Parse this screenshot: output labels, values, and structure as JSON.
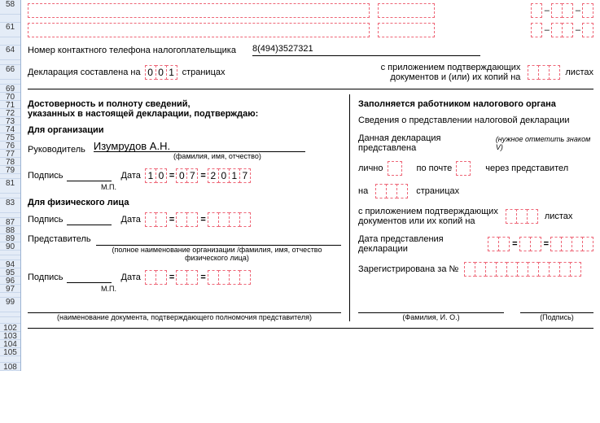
{
  "rownums": [
    "58",
    "",
    "61",
    "",
    "64",
    "",
    "66",
    "",
    "69",
    "70",
    "71",
    "72",
    "73",
    "74",
    "75",
    "76",
    "77",
    "78",
    "79",
    "",
    "81",
    "",
    "83",
    "",
    "87",
    "88",
    "89",
    "90",
    "",
    "",
    "94",
    "95",
    "96",
    "97",
    "",
    "99",
    "",
    "",
    "102",
    "103",
    "104",
    "105",
    "",
    "108"
  ],
  "rownum_heights": [
    18,
    10,
    18,
    10,
    18,
    6,
    18,
    6,
    10,
    10,
    10,
    10,
    10,
    10,
    10,
    10,
    10,
    10,
    10,
    6,
    18,
    6,
    18,
    6,
    10,
    10,
    10,
    10,
    6,
    6,
    10,
    10,
    10,
    10,
    6,
    18,
    6,
    8,
    10,
    10,
    10,
    10,
    8,
    10
  ],
  "phone": {
    "label": "Номер контактного телефона налогоплательщика",
    "value": "8(494)3527321"
  },
  "pages": {
    "prefix": "Декларация составлена на",
    "d": [
      "0",
      "0",
      "1"
    ],
    "suffix": "страницах"
  },
  "attach1": {
    "line1": "с приложением подтверждающих",
    "line2": "документов и (или) их копий на",
    "suffix": "листах"
  },
  "left": {
    "heading": [
      "Достоверность и полноту сведений,",
      "указанных в настоящей декларации, подтверждаю:"
    ],
    "org": "Для организации",
    "ruk": {
      "label": "Руководитель",
      "name": "Изумрудов А.Н.",
      "hint": "(фамилия, имя, отчество)"
    },
    "sign": {
      "label": "Подпись",
      "mp": "М.П.",
      "date": "Дата"
    },
    "date1": {
      "d": [
        "1",
        "0"
      ],
      "m": [
        "0",
        "7"
      ],
      "y": [
        "2",
        "0",
        "1",
        "7"
      ]
    },
    "fiz": "Для физического лица",
    "pred": {
      "label": "Представитель",
      "hint": "(полное наименование организации /фамилия, имя, отчество физического лица)"
    },
    "dochint": "(наименование документа, подтверждающего полномочия представителя)"
  },
  "right": {
    "heading": "Заполняется работником налогового органа",
    "sub": "Сведения о представлении налоговой декларации",
    "submitted": "Данная декларация представлена",
    "italichint": "(нужное отметить знаком V)",
    "inperson": "лично",
    "bymail": "по почте",
    "byrep": "через представител",
    "on": "на",
    "pages": "страницах",
    "attach_line1": "с приложением подтверждающих",
    "attach_line2": "документов или их копий на",
    "attach_suffix": "листах",
    "date_label1": "Дата представления",
    "date_label2": "декларации",
    "reg": "Зарегистрирована за №",
    "fio_hint": "(Фамилия, И. О.)",
    "sign_hint": "(Подпись)"
  }
}
